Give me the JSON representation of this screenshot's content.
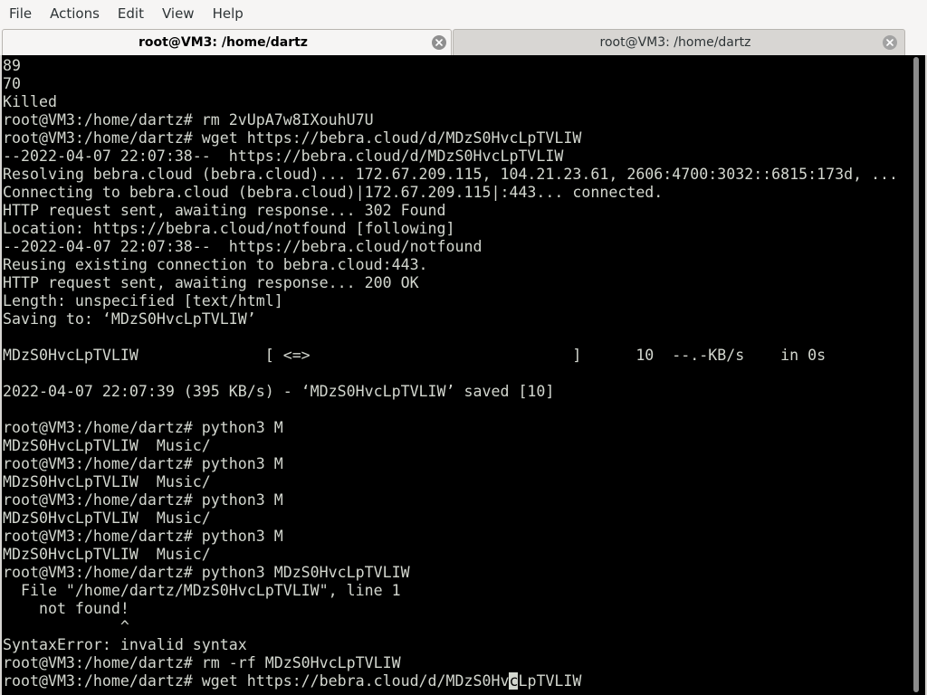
{
  "menu": {
    "items": [
      "File",
      "Actions",
      "Edit",
      "View",
      "Help"
    ]
  },
  "tabs": [
    {
      "label": "root@VM3: /home/dartz",
      "active": true
    },
    {
      "label": "root@VM3: /home/dartz",
      "active": false
    }
  ],
  "terminal": {
    "lines": [
      "89",
      "70",
      "Killed",
      "root@VM3:/home/dartz# rm 2vUpA7w8IXouhU7U",
      "root@VM3:/home/dartz# wget https://bebra.cloud/d/MDzS0HvcLpTVLIW",
      "--2022-04-07 22:07:38--  https://bebra.cloud/d/MDzS0HvcLpTVLIW",
      "Resolving bebra.cloud (bebra.cloud)... 172.67.209.115, 104.21.23.61, 2606:4700:3032::6815:173d, ...",
      "Connecting to bebra.cloud (bebra.cloud)|172.67.209.115|:443... connected.",
      "HTTP request sent, awaiting response... 302 Found",
      "Location: https://bebra.cloud/notfound [following]",
      "--2022-04-07 22:07:38--  https://bebra.cloud/notfound",
      "Reusing existing connection to bebra.cloud:443.",
      "HTTP request sent, awaiting response... 200 OK",
      "Length: unspecified [text/html]",
      "Saving to: ‘MDzS0HvcLpTVLIW’",
      "",
      "MDzS0HvcLpTVLIW              [ <=>                             ]      10  --.-KB/s    in 0s",
      "",
      "2022-04-07 22:07:39 (395 KB/s) - ‘MDzS0HvcLpTVLIW’ saved [10]",
      "",
      "root@VM3:/home/dartz# python3 M",
      "MDzS0HvcLpTVLIW  Music/",
      "root@VM3:/home/dartz# python3 M",
      "MDzS0HvcLpTVLIW  Music/",
      "root@VM3:/home/dartz# python3 M",
      "MDzS0HvcLpTVLIW  Music/",
      "root@VM3:/home/dartz# python3 M",
      "MDzS0HvcLpTVLIW  Music/",
      "root@VM3:/home/dartz# python3 MDzS0HvcLpTVLIW",
      "  File \"/home/dartz/MDzS0HvcLpTVLIW\", line 1",
      "    not found!",
      "             ^",
      "SyntaxError: invalid syntax",
      "root@VM3:/home/dartz# rm -rf MDzS0HvcLpTVLIW"
    ],
    "last_line_before_cursor": "root@VM3:/home/dartz# wget https://bebra.cloud/d/MDzS0Hv",
    "cursor_char": "c",
    "last_line_after_cursor": "LpTVLIW"
  },
  "icons": {
    "tab_close": "close-icon"
  },
  "colors": {
    "terminal_bg": "#000000",
    "terminal_fg": "#d3d7cf",
    "window_bg": "#f6f5f4"
  }
}
